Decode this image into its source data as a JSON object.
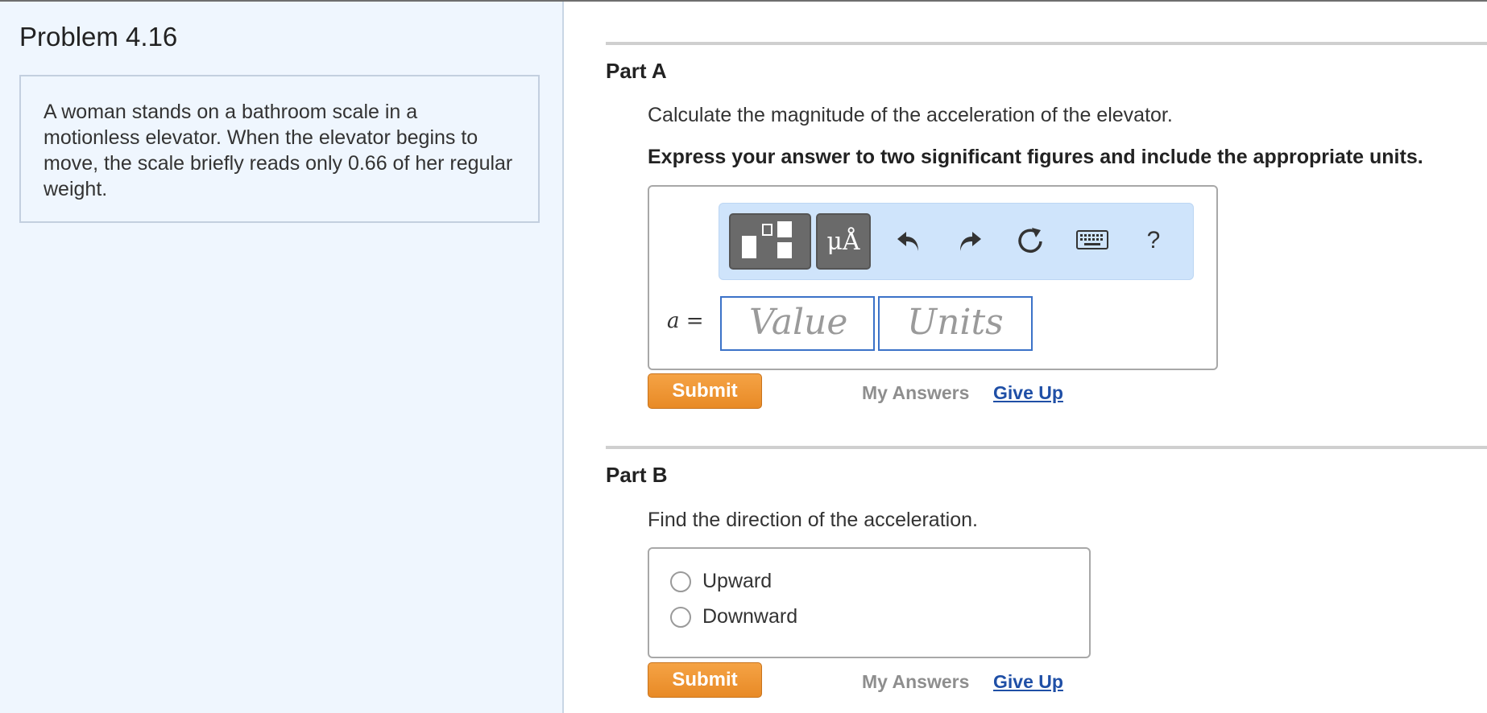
{
  "problem": {
    "title": "Problem 4.16",
    "text": "A woman stands on a bathroom scale in a motionless elevator. When the elevator begins to move, the scale briefly reads only 0.66 of her regular weight."
  },
  "part_a": {
    "title": "Part A",
    "question": "Calculate the magnitude of the acceleration of the elevator.",
    "instruction": "Express your answer to two significant figures and include the appropriate units.",
    "variable": "a",
    "equals": "=",
    "value_placeholder": "Value",
    "units_placeholder": "Units",
    "toolbar": {
      "units_label": "μÅ",
      "help_label": "?",
      "icons": [
        "templates-icon",
        "units-icon",
        "undo-icon",
        "redo-icon",
        "reset-icon",
        "keyboard-icon",
        "help-icon"
      ]
    },
    "submit_label": "Submit",
    "my_answers_label": "My Answers",
    "give_up_label": "Give Up"
  },
  "part_b": {
    "title": "Part B",
    "question": "Find the direction of the acceleration.",
    "options": [
      "Upward",
      "Downward"
    ],
    "submit_label": "Submit",
    "my_answers_label": "My Answers",
    "give_up_label": "Give Up"
  },
  "colors": {
    "submit": "#e88a26",
    "link": "#1f4fa6",
    "left_pane": "#eff6fe",
    "toolbar": "#cfe4fb",
    "input_border": "#3b72c8"
  }
}
